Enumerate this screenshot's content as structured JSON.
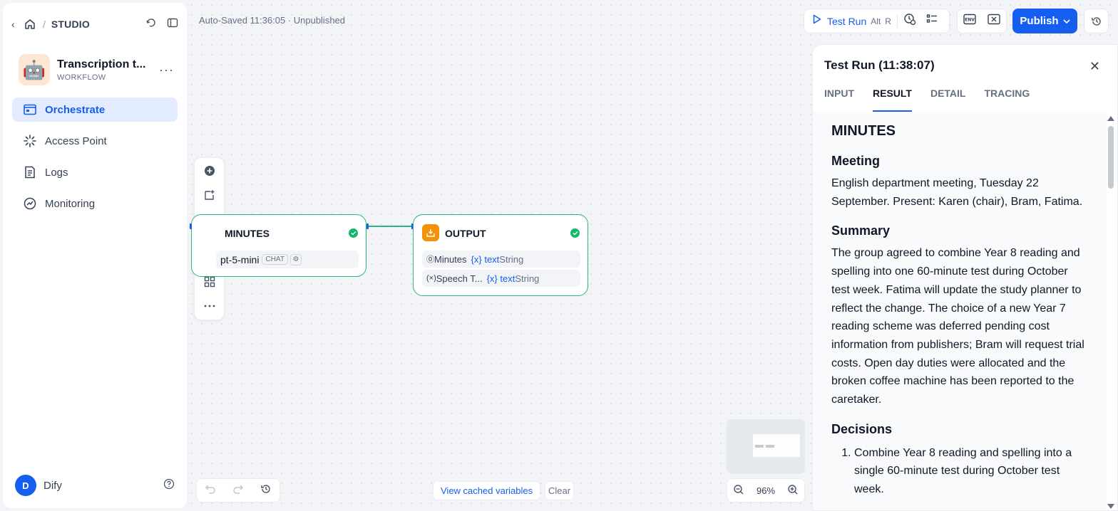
{
  "nav_top": {
    "studio": "STUDIO"
  },
  "app": {
    "title": "Transcription t...",
    "type": "WORKFLOW",
    "avatar": "🤖",
    "more": "···"
  },
  "sidebar": {
    "items": [
      {
        "label": "Orchestrate",
        "icon": "orchestrate-icon",
        "active": true
      },
      {
        "label": "Access Point",
        "icon": "access-point-icon"
      },
      {
        "label": "Logs",
        "icon": "logs-icon"
      },
      {
        "label": "Monitoring",
        "icon": "monitoring-icon"
      }
    ],
    "user": {
      "initial": "D",
      "name": "Dify"
    }
  },
  "header": {
    "autosave": "Auto-Saved 11:36:05 · Unpublished",
    "test_run": "Test Run",
    "kbd_alt": "Alt",
    "kbd_r": "R",
    "publish": "Publish",
    "env_label": "ENV"
  },
  "nodes": {
    "minutes": {
      "title": "MINUTES",
      "model": "pt-5-mini",
      "badge": "CHAT"
    },
    "output": {
      "title": "OUTPUT",
      "rows": [
        {
          "name": "Minutes",
          "prefix": "⓪",
          "var": "{x} text",
          "type": "String"
        },
        {
          "name": "Speech T...",
          "prefix": "(×)",
          "var": "{x} text",
          "type": "String"
        }
      ]
    }
  },
  "canvas_controls": {
    "view_cached": "View cached variables",
    "clear": "Clear",
    "zoom": "96%"
  },
  "panel": {
    "title": "Test Run (11:38:07)",
    "tabs": [
      "INPUT",
      "RESULT",
      "DETAIL",
      "TRACING"
    ],
    "active_tab": "RESULT",
    "result": {
      "h1": "MINUTES",
      "meeting_h": "Meeting",
      "meeting_p": "English department meeting, Tuesday 22 September. Present: Karen (chair), Bram, Fatima.",
      "summary_h": "Summary",
      "summary_p": "The group agreed to combine Year 8 reading and spelling into one 60-minute test during October test week. Fatima will update the study planner to reflect the change. The choice of a new Year 7 reading scheme was deferred pending cost information from publishers; Bram will request trial costs. Open day duties were allocated and the broken coffee machine has been reported to the caretaker.",
      "decisions_h": "Decisions",
      "decisions": [
        "Combine Year 8 reading and spelling into a single 60-minute test during October test week."
      ]
    }
  },
  "colors": {
    "accent": "#155eef",
    "success": "#12b76a",
    "node_border": "#2bb47e",
    "output_icon": "#f79009"
  }
}
